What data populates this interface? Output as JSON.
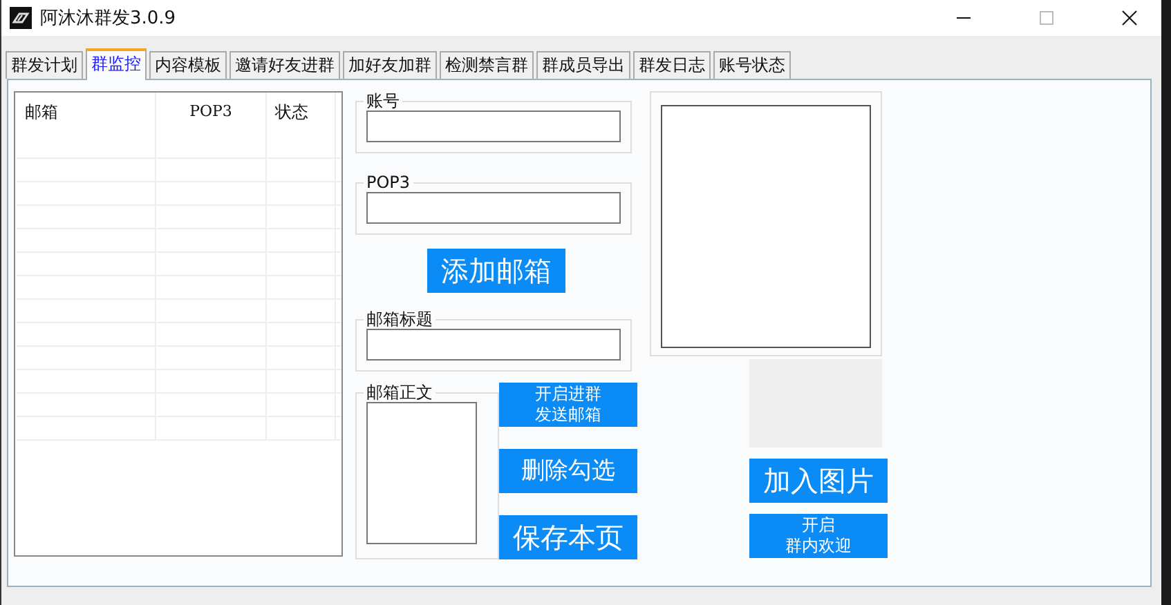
{
  "window": {
    "title": "阿沐沐群发3.0.9"
  },
  "tabs": [
    {
      "label": "群发计划",
      "selected": false
    },
    {
      "label": "群监控",
      "selected": true
    },
    {
      "label": "内容模板",
      "selected": false
    },
    {
      "label": "邀请好友进群",
      "selected": false
    },
    {
      "label": "加好友加群",
      "selected": false
    },
    {
      "label": "检测禁言群",
      "selected": false
    },
    {
      "label": "群成员导出",
      "selected": false
    },
    {
      "label": "群发日志",
      "selected": false
    },
    {
      "label": "账号状态",
      "selected": false
    }
  ],
  "table": {
    "columns": [
      "邮箱",
      "POP3",
      "状态"
    ]
  },
  "fields": [
    {
      "label": "账号"
    },
    {
      "label": "POP3"
    }
  ],
  "add_button": {
    "lines": [
      "添加邮箱"
    ]
  },
  "subject_field": {
    "label": "邮箱标题"
  },
  "body_field": {
    "label": "邮箱正文"
  },
  "action_buttons": [
    {
      "lines": [
        "开启进群",
        "发送邮箱"
      ]
    },
    {
      "lines": [
        "删除勾选"
      ]
    },
    {
      "lines": [
        "保存本页"
      ]
    }
  ],
  "image_buttons": [
    {
      "lines": [
        "加入图片"
      ]
    },
    {
      "lines": [
        "开启",
        "群内欢迎"
      ]
    }
  ]
}
